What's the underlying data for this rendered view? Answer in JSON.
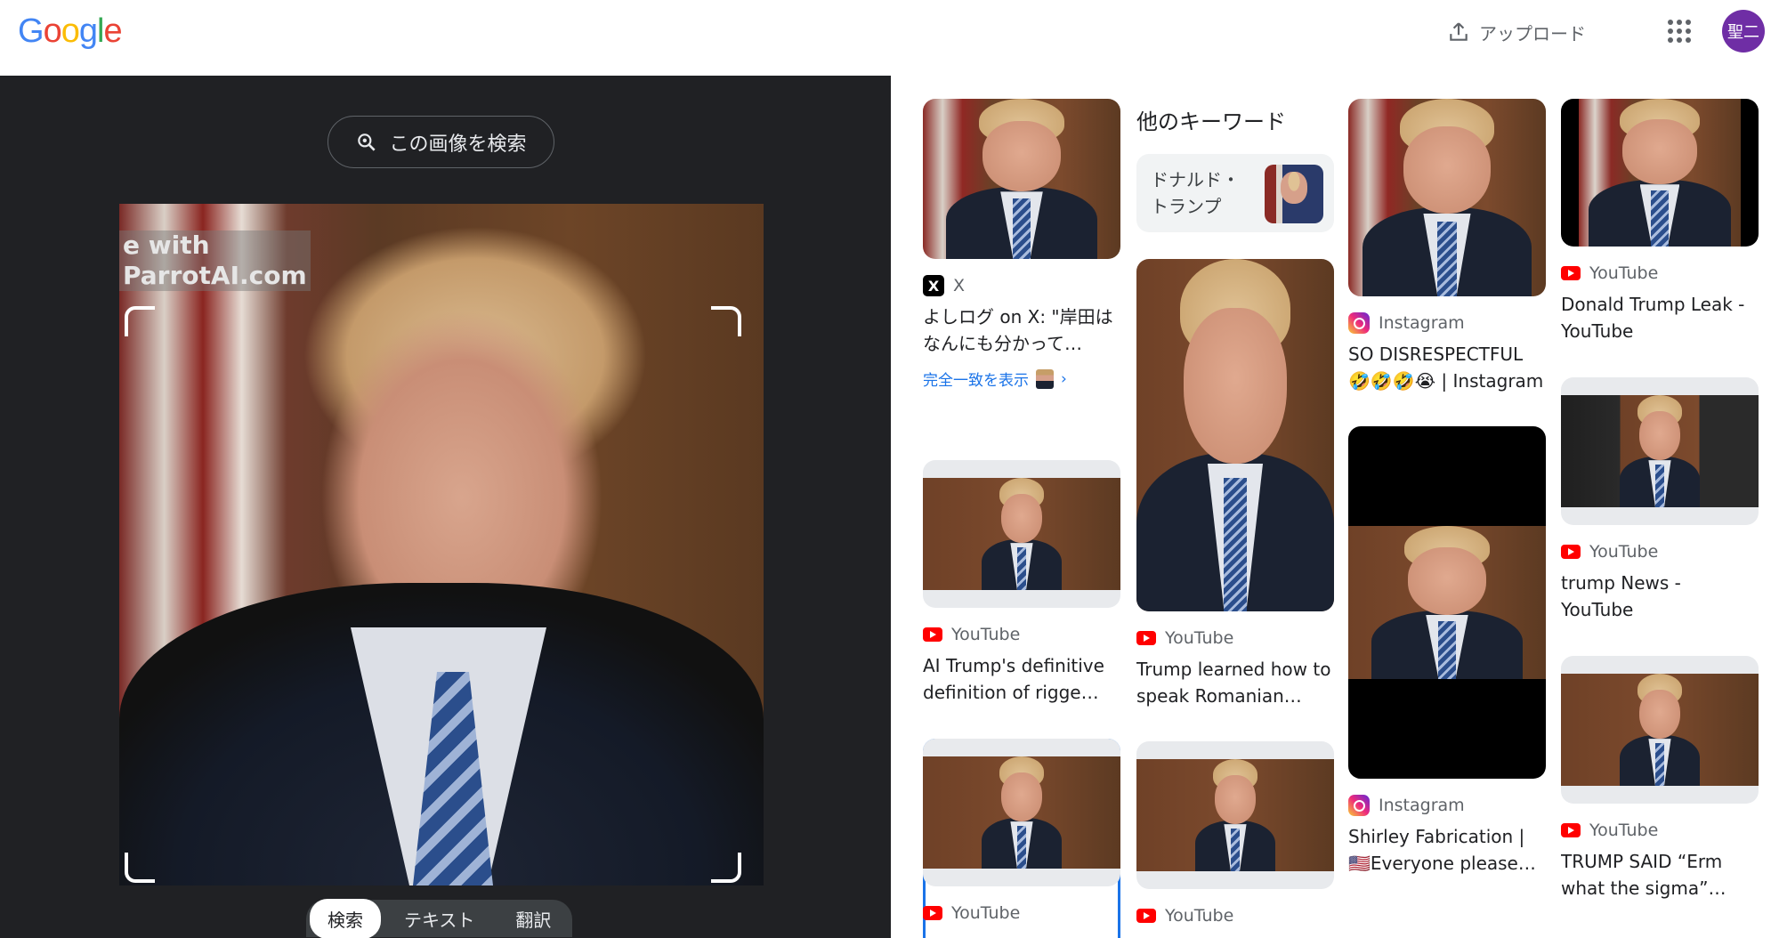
{
  "header": {
    "logo_letters": [
      "G",
      "o",
      "o",
      "g",
      "l",
      "e"
    ],
    "logo_colors": [
      "#4285f4",
      "#ea4335",
      "#fbbc05",
      "#4285f4",
      "#34a853",
      "#ea4335"
    ],
    "upload_label": "アップロード",
    "avatar_text": "聖二"
  },
  "left_panel": {
    "search_image_label": "この画像を検索",
    "watermark_line1": "e with",
    "watermark_line2": "ParrotAI.com",
    "tabs": [
      "検索",
      "テキスト",
      "翻訳"
    ],
    "active_tab": "検索"
  },
  "keywords": {
    "heading": "他のキーワード",
    "chip_label": "ドナルド・トランプ"
  },
  "results": {
    "col1": [
      {
        "source": "X",
        "icon": "x-icon",
        "title": "よしログ on X: \"岸田はなんにも分かって…",
        "exact_match": "完全一致を表示"
      },
      {
        "source": "YouTube",
        "icon": "youtube-icon",
        "title": "AI Trump's definitive definition of rigge…"
      },
      {
        "source": "YouTube",
        "icon": "youtube-icon",
        "title": ""
      }
    ],
    "col2": [
      {
        "source": "YouTube",
        "icon": "youtube-icon",
        "title": "Trump learned how to speak Romanian…"
      },
      {
        "source": "YouTube",
        "icon": "youtube-icon",
        "title": ""
      }
    ],
    "col3": [
      {
        "source": "Instagram",
        "icon": "instagram-icon",
        "title": "SO DISRESPECTFUL 🤣🤣🤣😭 | Instagram"
      },
      {
        "source": "Instagram",
        "icon": "instagram-icon",
        "title": "Shirley Fabrication | 🇺🇸Everyone please…"
      }
    ],
    "col4": [
      {
        "source": "YouTube",
        "icon": "youtube-icon",
        "title": "Donald Trump Leak - YouTube"
      },
      {
        "source": "YouTube",
        "icon": "youtube-icon",
        "title": "trump News - YouTube"
      },
      {
        "source": "YouTube",
        "icon": "youtube-icon",
        "title": "TRUMP SAID “Erm what the sigma”…"
      }
    ]
  }
}
